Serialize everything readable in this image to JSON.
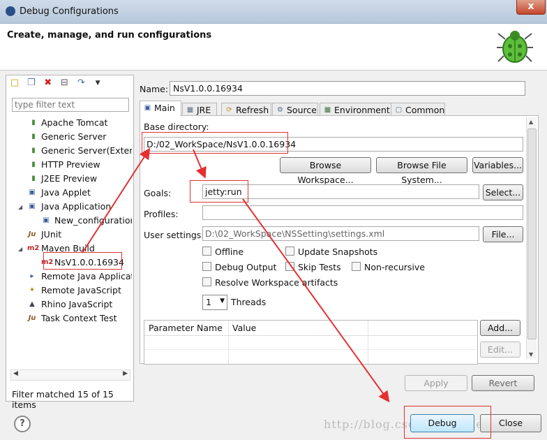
{
  "window": {
    "title": "Debug Configurations",
    "close_glyph": "x"
  },
  "header": {
    "title": "Create, manage, and run configurations"
  },
  "left": {
    "toolbar": [
      "new-config-icon",
      "duplicate-icon",
      "delete-icon",
      "collapse-all-icon",
      "filter-icon",
      "dropdown-icon"
    ],
    "filter_placeholder": "type filter text",
    "items": [
      {
        "label": "Apache Tomcat"
      },
      {
        "label": "Generic Server"
      },
      {
        "label": "Generic Server(Extern"
      },
      {
        "label": "HTTP Preview"
      },
      {
        "label": "J2EE Preview"
      },
      {
        "label": "Java Applet"
      },
      {
        "label": "Java Application"
      },
      {
        "label": "New_configuration"
      },
      {
        "label": "JUnit"
      },
      {
        "label": "Maven Build"
      },
      {
        "label": "NsV1.0.0.16934"
      },
      {
        "label": "Remote Java Applicat"
      },
      {
        "label": "Remote JavaScript"
      },
      {
        "label": "Rhino JavaScript"
      },
      {
        "label": "Task Context Test"
      }
    ],
    "filter_message": "Filter matched 15 of 15 items",
    "icon_text": {
      "m2": "m2",
      "ju": "Ju"
    }
  },
  "right": {
    "name_label": "Name:",
    "name_value": "NsV1.0.0.16934",
    "tabs": [
      "Main",
      "JRE",
      "Refresh",
      "Source",
      "Environment",
      "Common"
    ],
    "base_dir_label": "Base directory:",
    "base_dir_value": "D:/02_WorkSpace/NsV1.0.0.16934",
    "browse_workspace": "Browse Workspace...",
    "browse_fs": "Browse File System...",
    "variables": "Variables...",
    "goals_label": "Goals:",
    "goals_value": "jetty:run",
    "select_btn": "Select...",
    "profiles_label": "Profiles:",
    "profiles_value": "",
    "user_settings_label": "User settings:",
    "user_settings_value": "D:\\02_WorkSpace\\NSSetting\\settings.xml",
    "file_btn": "File...",
    "checks": {
      "offline": "Offline",
      "update_snapshots": "Update Snapshots",
      "debug_output": "Debug Output",
      "skip_tests": "Skip Tests",
      "non_recursive": "Non-recursive",
      "resolve_ws": "Resolve Workspace artifacts"
    },
    "threads_value": "1",
    "threads_label": "Threads",
    "param_headers": [
      "Parameter Name",
      "Value"
    ],
    "add_btn": "Add...",
    "edit_btn": "Edit...",
    "apply_btn": "Apply",
    "revert_btn": "Revert"
  },
  "footer": {
    "help": "?",
    "debug_btn": "Debug",
    "close_btn": "Close",
    "watermark": "http://blog.csdn.net/lizhenlin.cn"
  }
}
